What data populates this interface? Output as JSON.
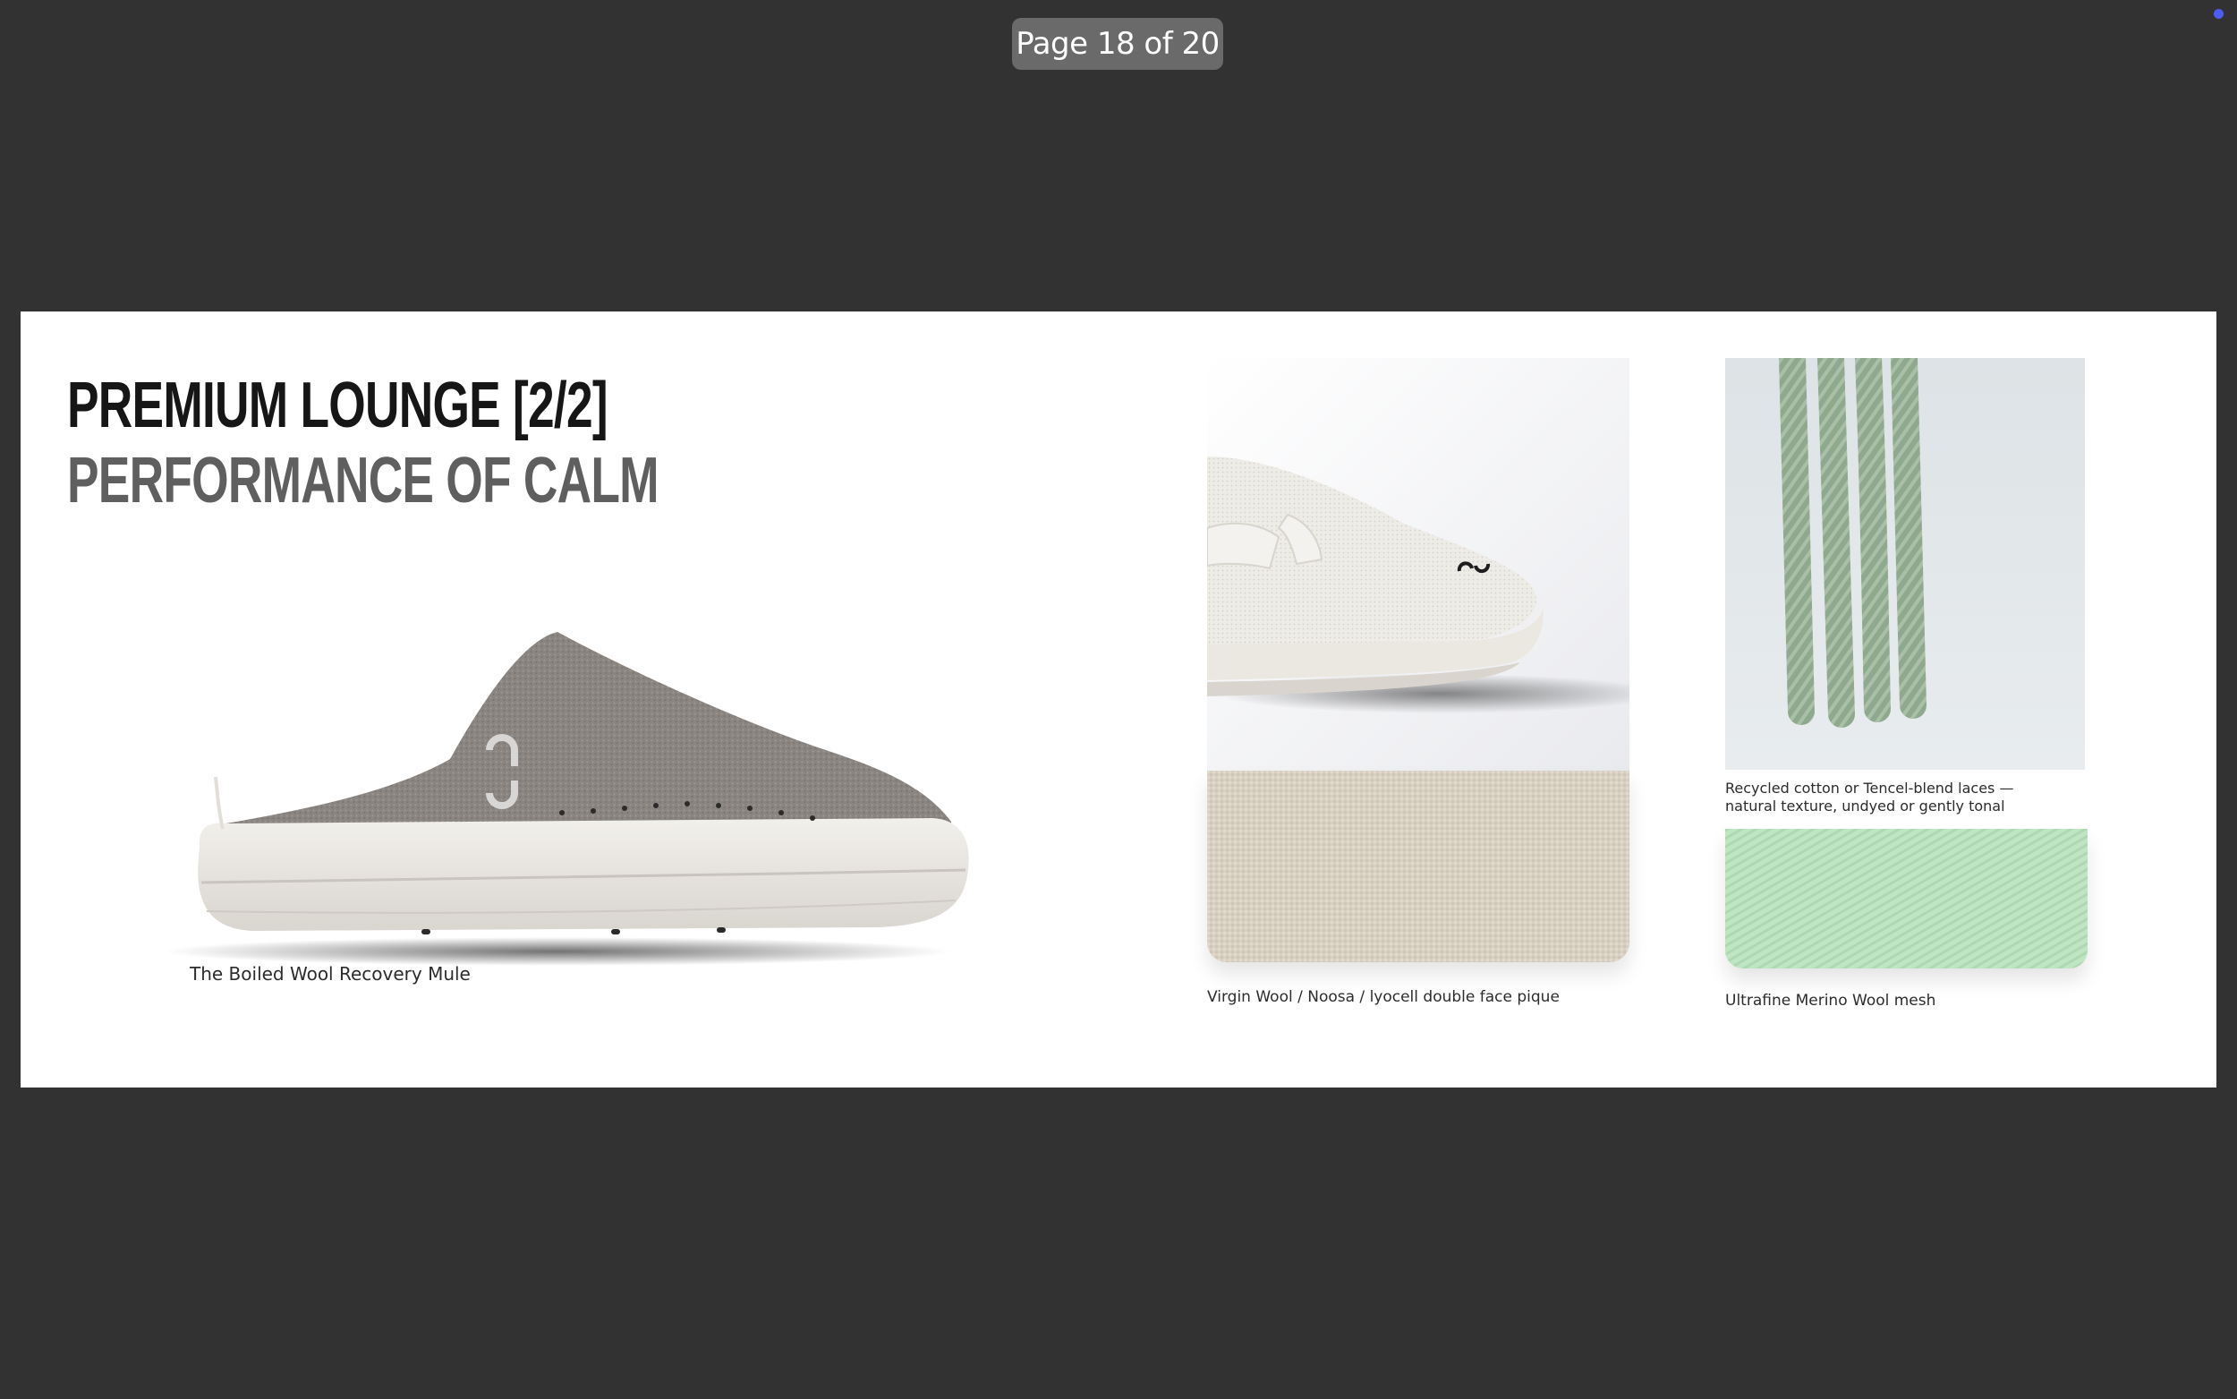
{
  "viewer": {
    "page_indicator": "Page 18 of 20"
  },
  "slide": {
    "title_line1": "PREMIUM LOUNGE [2/2]",
    "title_line2": "PERFORMANCE OF CALM",
    "mule": {
      "caption": "The Boiled Wool Recovery Mule",
      "brand_mark": "on"
    },
    "pique": {
      "caption": "Virgin Wool / Noosa / lyocell double face pique"
    },
    "laces": {
      "caption": "Recycled cotton or Tencel-blend laces — natural texture, undyed or gently tonal"
    },
    "mesh": {
      "caption": "Ultrafine Merino Wool mesh"
    }
  },
  "colors": {
    "app_background": "#323232",
    "indicator_background": "#6a6a6a",
    "status_dot": "#4d5cf5",
    "title_primary": "#161616",
    "title_secondary": "#5f5f5f",
    "wool_upper": "#8a8581",
    "sole": "#e9e6e1",
    "pique": "#d8d0c2",
    "lace_green": "#8fa98f",
    "mesh_green": "#bfe6c2"
  }
}
